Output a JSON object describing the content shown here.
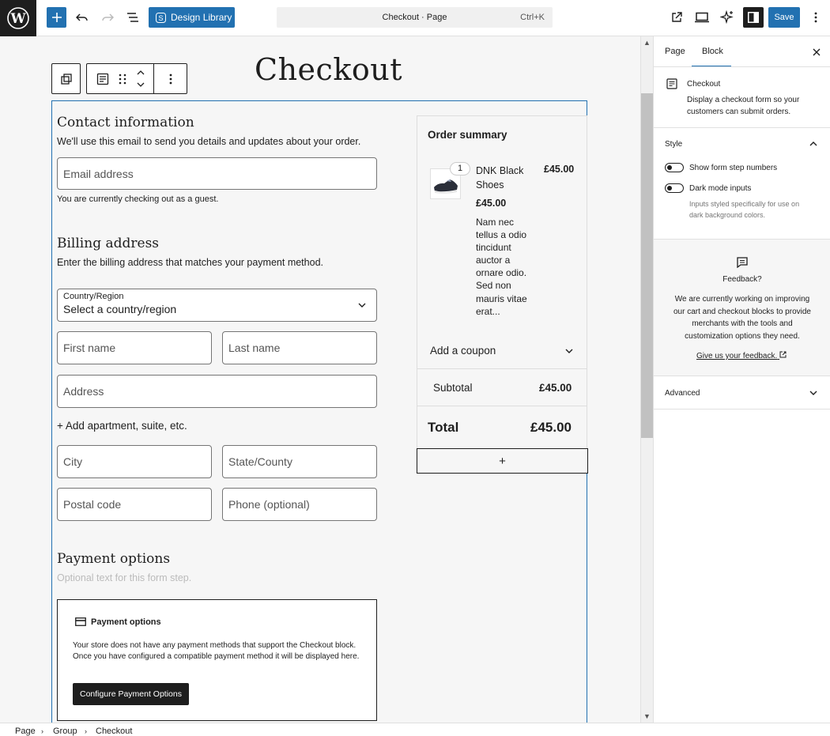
{
  "topbar": {
    "design_library": "Design Library",
    "command_title": "Checkout · Page",
    "command_shortcut": "Ctrl+K",
    "save_label": "Save"
  },
  "page": {
    "title": "Checkout"
  },
  "contact": {
    "heading": "Contact information",
    "description": "We'll use this email to send you details and updates about your order.",
    "email_placeholder": "Email address",
    "guest_note": "You are currently checking out as a guest."
  },
  "billing": {
    "heading": "Billing address",
    "description": "Enter the billing address that matches your payment method.",
    "country_label": "Country/Region",
    "country_value": "Select a country/region",
    "first_name": "First name",
    "last_name": "Last name",
    "address": "Address",
    "add_apartment": "+ Add apartment, suite, etc.",
    "city": "City",
    "state": "State/County",
    "postal": "Postal code",
    "phone": "Phone (optional)"
  },
  "payment": {
    "heading": "Payment options",
    "optional_text": "Optional text for this form step.",
    "box_title": "Payment options",
    "box_text": "Your store does not have any payment methods that support the Checkout block. Once you have configured a compatible payment method it will be displayed here.",
    "configure_button": "Configure Payment Options"
  },
  "summary": {
    "heading": "Order summary",
    "item": {
      "quantity": "1",
      "name_line1": "DNK Black",
      "name_line2": "Shoes",
      "price_right": "£45.00",
      "price": "£45.00",
      "desc_lines": [
        "Nam nec",
        "tellus a odio",
        "tincidunt",
        "auctor a",
        "ornare odio.",
        "Sed non",
        "mauris vitae",
        "erat..."
      ]
    },
    "coupon": "Add a coupon",
    "subtotal_label": "Subtotal",
    "subtotal_value": "£45.00",
    "total_label": "Total",
    "total_value": "£45.00",
    "add_block": "+"
  },
  "sidebar": {
    "tab_page": "Page",
    "tab_block": "Block",
    "block_name": "Checkout",
    "block_desc_1": "Display a checkout form so your",
    "block_desc_2": "customers can submit orders.",
    "style_heading": "Style",
    "toggle_step_numbers": "Show form step numbers",
    "toggle_dark_mode": "Dark mode inputs",
    "dark_help_1": "Inputs styled specifically for use on",
    "dark_help_2": "dark background colors.",
    "feedback_title": "Feedback?",
    "feedback_lines": [
      "We are currently working on improving",
      "our cart and checkout blocks to provide",
      "merchants with the tools and",
      "customization options they need."
    ],
    "feedback_link": "Give us your feedback.",
    "advanced": "Advanced"
  },
  "breadcrumbs": [
    "Page",
    "Group",
    "Checkout"
  ],
  "colors": {
    "accent": "#2271b1",
    "dark": "#1e1e1e"
  }
}
